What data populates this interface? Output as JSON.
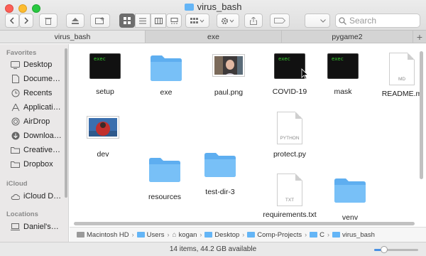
{
  "window": {
    "title": "virus_bash"
  },
  "toolbar": {
    "search_placeholder": "Search"
  },
  "tabs": [
    {
      "label": "virus_bash",
      "active": true
    },
    {
      "label": "exe",
      "active": false
    },
    {
      "label": "pygame2",
      "active": false
    }
  ],
  "sidebar": {
    "favorites_header": "Favorites",
    "favorites": [
      {
        "label": "Desktop",
        "icon": "desktop-icon"
      },
      {
        "label": "Docume…",
        "icon": "documents-icon"
      },
      {
        "label": "Recents",
        "icon": "clock-icon"
      },
      {
        "label": "Applicati…",
        "icon": "applications-icon"
      },
      {
        "label": "AirDrop",
        "icon": "airdrop-icon"
      },
      {
        "label": "Downloa…",
        "icon": "downloads-icon"
      },
      {
        "label": "Creative…",
        "icon": "folder-icon"
      },
      {
        "label": "Dropbox",
        "icon": "folder-icon"
      }
    ],
    "icloud_header": "iCloud",
    "icloud": [
      {
        "label": "iCloud D…",
        "icon": "cloud-icon"
      }
    ],
    "locations_header": "Locations",
    "locations": [
      {
        "label": "Daniel's…",
        "icon": "laptop-icon"
      }
    ]
  },
  "files": [
    {
      "name": "setup",
      "kind": "exec"
    },
    {
      "name": "exe",
      "kind": "folder"
    },
    {
      "name": "paul.png",
      "kind": "image"
    },
    {
      "name": "COVID-19",
      "kind": "exec"
    },
    {
      "name": "mask",
      "kind": "exec"
    },
    {
      "name": "README.m",
      "kind": "doc",
      "badge": "MD"
    },
    {
      "name": "dev",
      "kind": "image"
    },
    {
      "name": "protect.py",
      "kind": "doc",
      "badge": "PYTHON"
    },
    {
      "name": "resources",
      "kind": "folder"
    },
    {
      "name": "test-dir-3",
      "kind": "folder"
    },
    {
      "name": "requirements.txt",
      "kind": "doc",
      "badge": "TXT"
    },
    {
      "name": "venv",
      "kind": "folder"
    }
  ],
  "exec_label": "exec",
  "path": [
    "Macintosh HD",
    "Users",
    "kogan",
    "Desktop",
    "Comp-Projects",
    "C",
    "virus_bash"
  ],
  "status": {
    "text": "14 items, 44.2 GB available",
    "zoom_level": 0.22
  },
  "colors": {
    "folder": "#64b5f6",
    "sidebar_bg": "#eae8e8",
    "accent": "#4a90e2"
  }
}
